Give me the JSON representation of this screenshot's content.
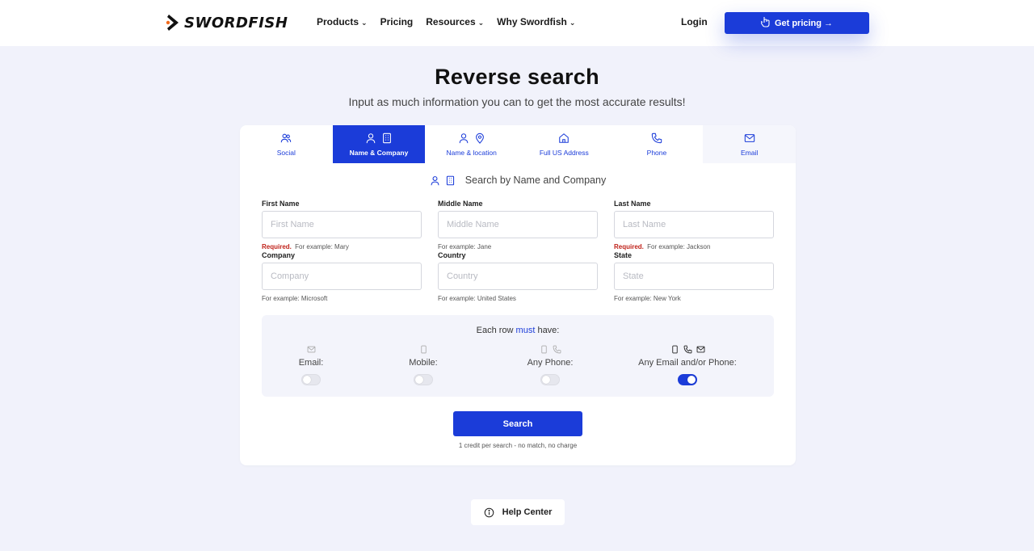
{
  "brand": {
    "name": "SWORDFISH",
    "accent": "#1b3cd9",
    "logo_dot": "#f26b1d"
  },
  "nav": {
    "items": [
      {
        "label": "Products",
        "dropdown": true
      },
      {
        "label": "Pricing",
        "dropdown": false
      },
      {
        "label": "Resources",
        "dropdown": true
      },
      {
        "label": "Why Swordfish",
        "dropdown": true
      }
    ],
    "login": "Login",
    "cta": "Get pricing →"
  },
  "page": {
    "title": "Reverse search",
    "subtitle": "Input as much information you can to get the most accurate results!"
  },
  "tabs": [
    {
      "label": "Social",
      "icons": [
        "users-icon"
      ]
    },
    {
      "label": "Name & Company",
      "icons": [
        "user-icon",
        "building-icon"
      ],
      "active": true
    },
    {
      "label": "Name & location",
      "icons": [
        "user-icon",
        "location-pin-icon"
      ]
    },
    {
      "label": "Full US Address",
      "icons": [
        "home-icon"
      ]
    },
    {
      "label": "Phone",
      "icons": [
        "phone-icon"
      ]
    },
    {
      "label": "Email",
      "icons": [
        "mail-icon"
      ]
    }
  ],
  "form": {
    "heading": "Search by Name and Company",
    "fields": {
      "first_name": {
        "label": "First Name",
        "placeholder": "First Name",
        "required": "Required.",
        "hint": "For example: Mary"
      },
      "middle_name": {
        "label": "Middle Name",
        "placeholder": "Middle Name",
        "hint": "For example: Jane"
      },
      "last_name": {
        "label": "Last Name",
        "placeholder": "Last Name",
        "required": "Required.",
        "hint": "For example: Jackson"
      },
      "company": {
        "label": "Company",
        "placeholder": "Company",
        "hint": "For example: Microsoft"
      },
      "country": {
        "label": "Country",
        "placeholder": "Country",
        "hint": "For example: United States"
      },
      "state": {
        "label": "State",
        "placeholder": "State",
        "hint": "For example: New York"
      }
    },
    "must_have": {
      "prefix": "Each row ",
      "emphasis": "must",
      "suffix": " have:",
      "options": [
        {
          "label": "Email:",
          "icons": [
            "mail-icon"
          ],
          "enabled": false
        },
        {
          "label": "Mobile:",
          "icons": [
            "mobile-icon"
          ],
          "enabled": false
        },
        {
          "label": "Any Phone:",
          "icons": [
            "mobile-icon",
            "phone-icon"
          ],
          "enabled": false
        },
        {
          "label": "Any Email and/or Phone:",
          "icons": [
            "mobile-icon",
            "phone-icon",
            "mail-icon"
          ],
          "enabled": true
        }
      ]
    },
    "search_label": "Search",
    "credit_note": "1 credit per search - no match, no charge"
  },
  "help": {
    "label": "Help Center"
  }
}
